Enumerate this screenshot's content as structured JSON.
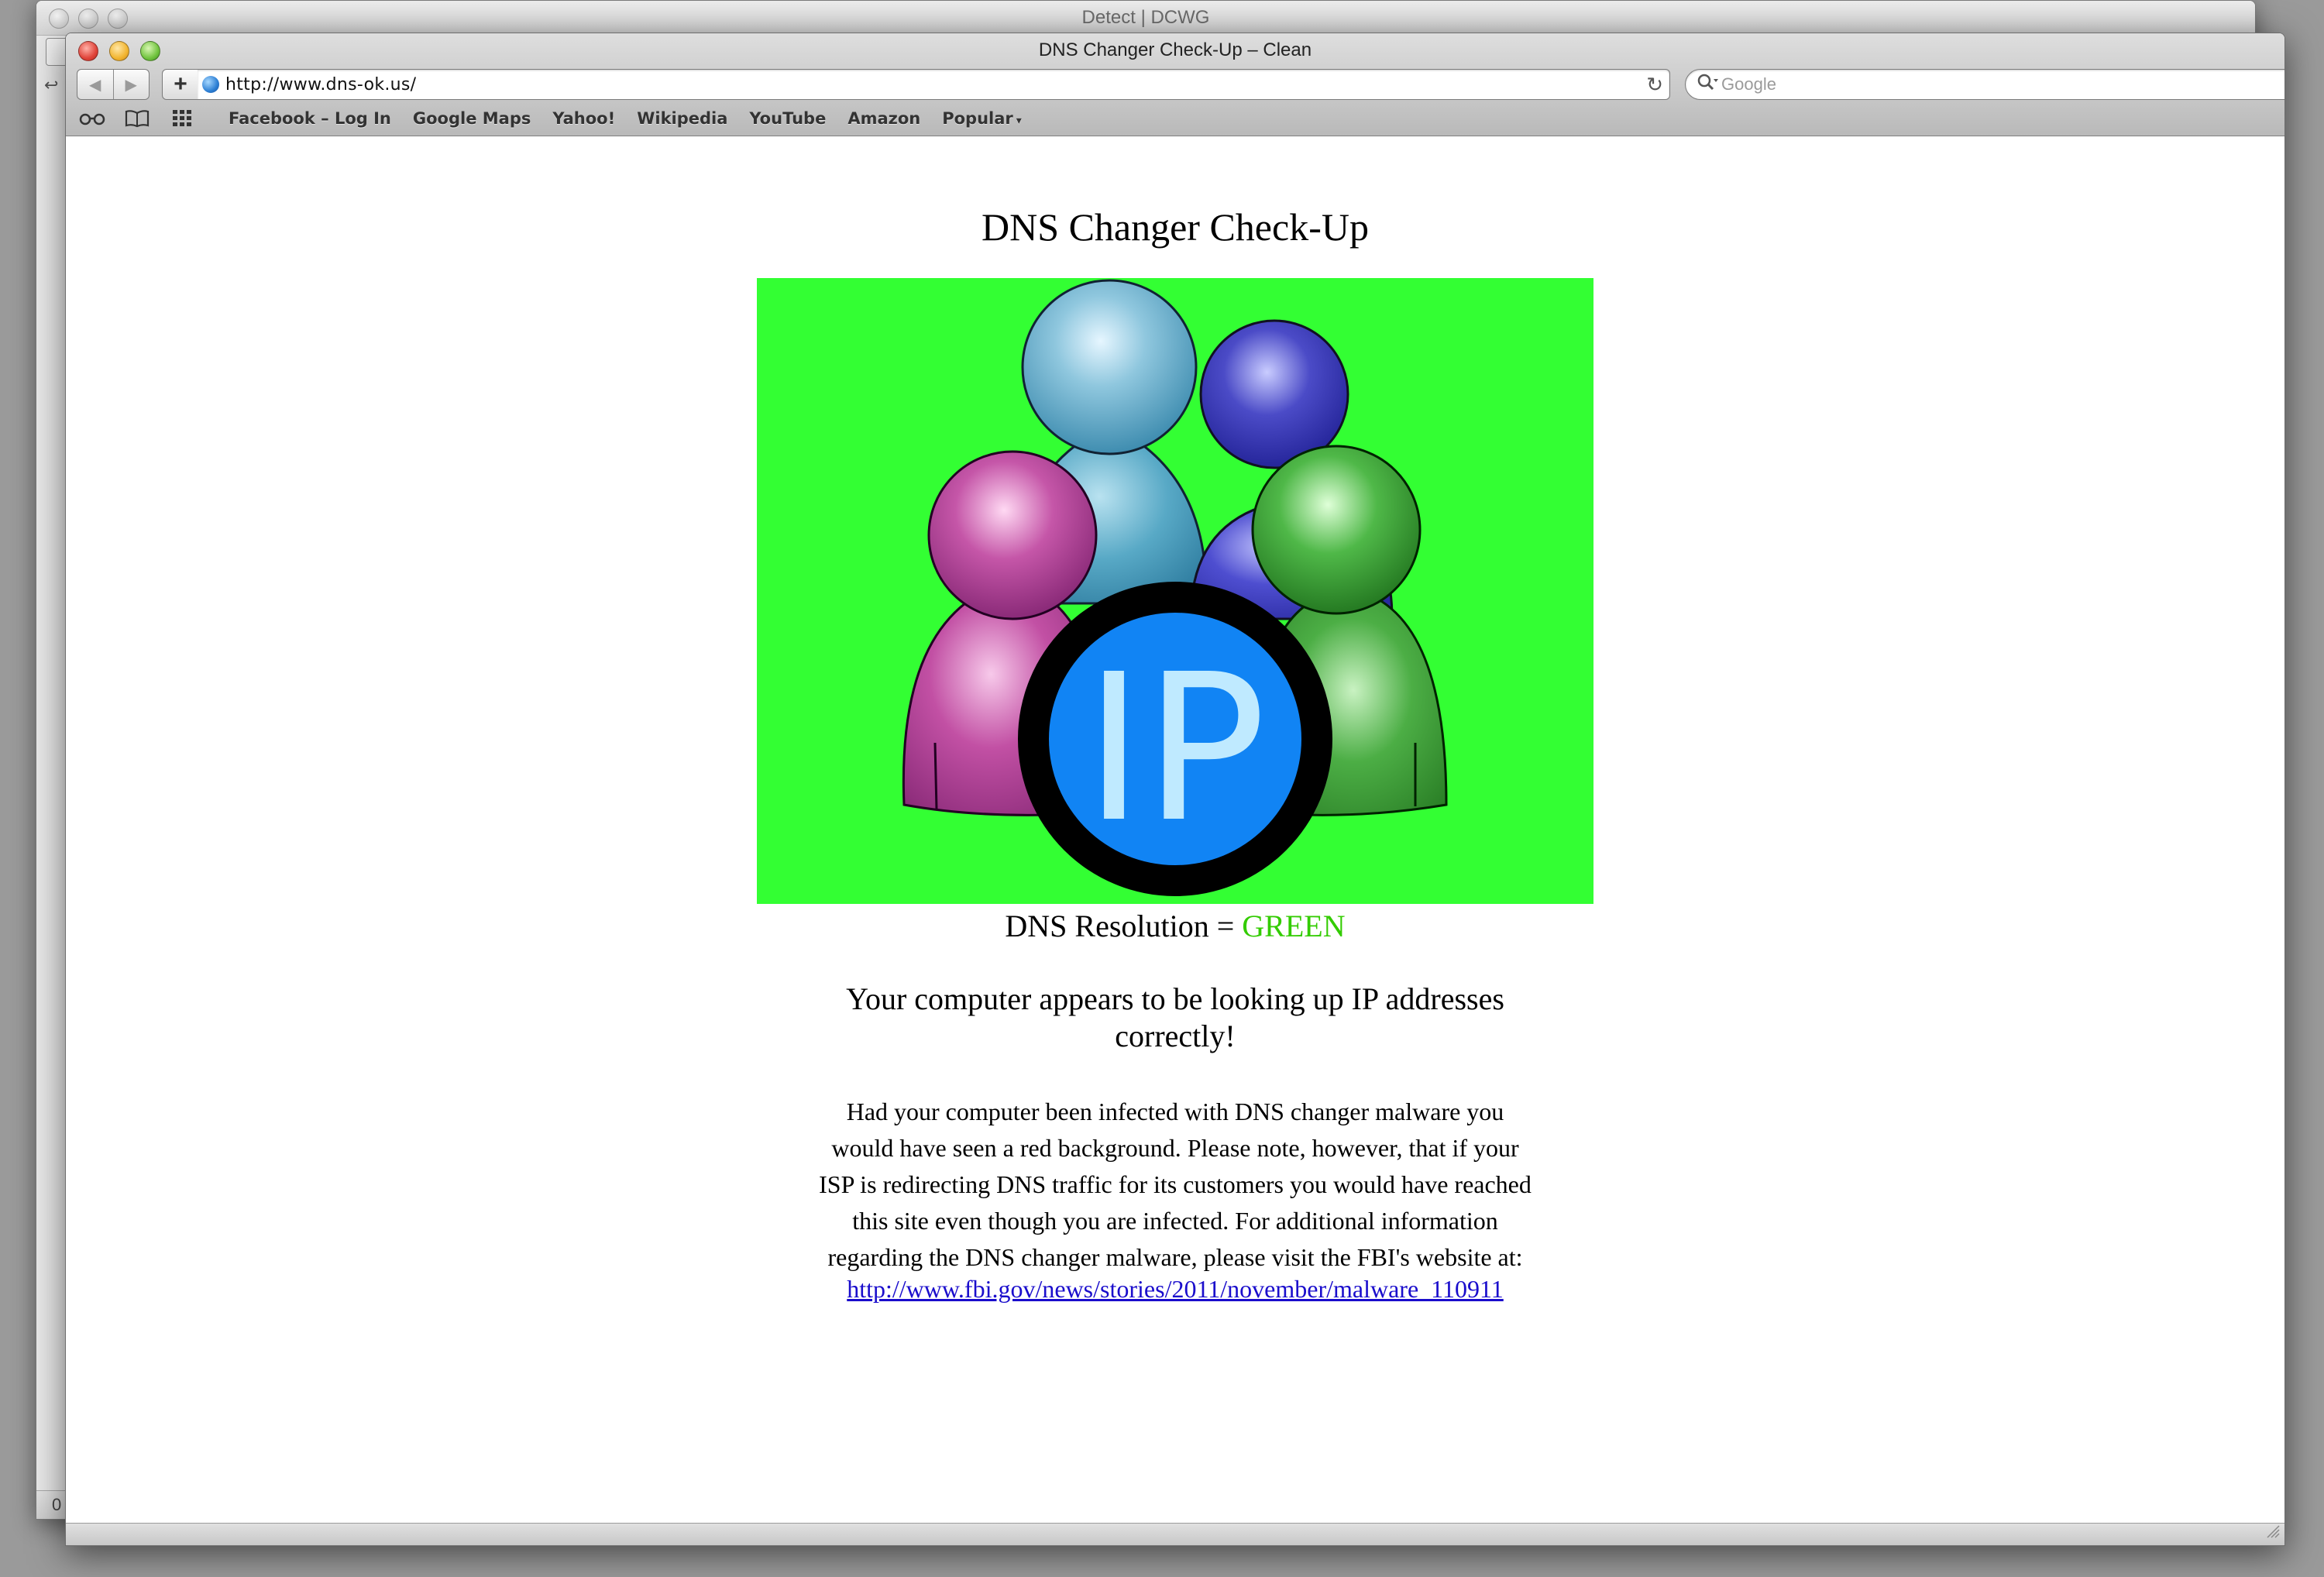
{
  "back_window": {
    "title": "Detect | DCWG",
    "edge_glyph": "↩",
    "status_glyph": "0"
  },
  "window": {
    "title": "DNS Changer Check-Up – Clean"
  },
  "toolbar": {
    "back_glyph": "◀",
    "forward_glyph": "▶",
    "add_glyph": "+",
    "url": "http://www.dns-ok.us/",
    "reload_glyph": "↻",
    "search_icon_glyph": "🔍",
    "search_placeholder": "Google"
  },
  "bookmarks": {
    "reading_list_glyph": "👓",
    "book_glyph": "📖",
    "grid_glyph": "▦",
    "items": [
      {
        "label": "Facebook – Log In"
      },
      {
        "label": "Google Maps"
      },
      {
        "label": "Yahoo!"
      },
      {
        "label": "Wikipedia"
      },
      {
        "label": "YouTube"
      },
      {
        "label": "Amazon"
      },
      {
        "label": "Popular"
      }
    ],
    "popular_arrow": "▾"
  },
  "page": {
    "title": "DNS Changer Check-Up",
    "hero_text": "IP",
    "hero_background": "#33ff33",
    "resolution_label": "DNS Resolution = ",
    "resolution_value": "GREEN",
    "resolution_color": "#33cc00",
    "headline": "Your computer appears to be looking up IP addresses correctly!",
    "body": "Had your computer been infected with DNS changer malware you would have seen a red background.  Please note, however, that if your ISP is redirecting DNS traffic for its customers you would have reached this site even though you are infected. For additional information regarding the DNS changer malware, please visit the FBI's website at:",
    "link": "http://www.fbi.gov/news/stories/2011/november/malware_110911"
  }
}
